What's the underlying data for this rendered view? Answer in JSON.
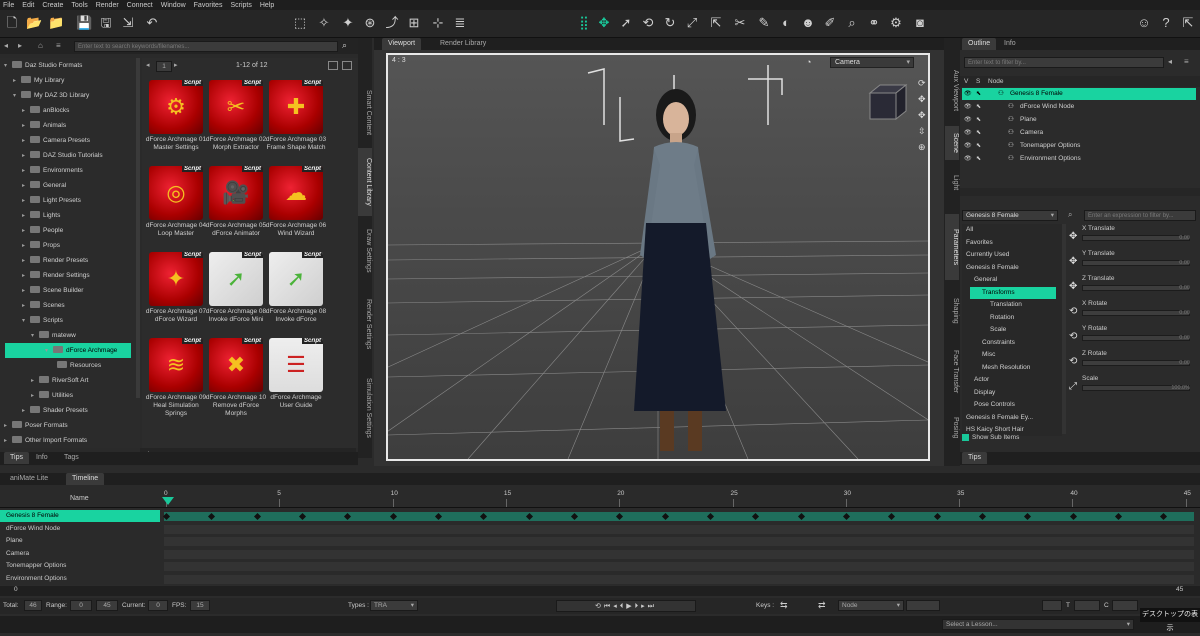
{
  "menu": [
    "File",
    "Edit",
    "Create",
    "Tools",
    "Render",
    "Connect",
    "Window",
    "Favorites",
    "Scripts",
    "Help"
  ],
  "left_panel": {
    "search_placeholder": "Enter text to search keywords/filenames...",
    "tree": [
      {
        "label": "Daz Studio Formats",
        "depth": 0,
        "arrow": "▾"
      },
      {
        "label": "My Library",
        "depth": 1,
        "arrow": "▸"
      },
      {
        "label": "My DAZ 3D Library",
        "depth": 1,
        "arrow": "▾"
      },
      {
        "label": "anBlocks",
        "depth": 2,
        "arrow": "▸"
      },
      {
        "label": "Animals",
        "depth": 2,
        "arrow": "▸"
      },
      {
        "label": "Camera Presets",
        "depth": 2,
        "arrow": "▸"
      },
      {
        "label": "DAZ Studio Tutorials",
        "depth": 2,
        "arrow": "▸"
      },
      {
        "label": "Environments",
        "depth": 2,
        "arrow": "▸"
      },
      {
        "label": "General",
        "depth": 2,
        "arrow": "▸"
      },
      {
        "label": "Light Presets",
        "depth": 2,
        "arrow": "▸"
      },
      {
        "label": "Lights",
        "depth": 2,
        "arrow": "▸"
      },
      {
        "label": "People",
        "depth": 2,
        "arrow": "▸"
      },
      {
        "label": "Props",
        "depth": 2,
        "arrow": "▸"
      },
      {
        "label": "Render Presets",
        "depth": 2,
        "arrow": "▸"
      },
      {
        "label": "Render Settings",
        "depth": 2,
        "arrow": "▸"
      },
      {
        "label": "Scene Builder",
        "depth": 2,
        "arrow": "▸"
      },
      {
        "label": "Scenes",
        "depth": 2,
        "arrow": "▸"
      },
      {
        "label": "Scripts",
        "depth": 2,
        "arrow": "▾"
      },
      {
        "label": "mateww",
        "depth": 3,
        "arrow": "▾"
      },
      {
        "label": "dForce Archmage",
        "depth": 4,
        "arrow": "▾",
        "selected": true
      },
      {
        "label": "Resources",
        "depth": 5,
        "arrow": ""
      },
      {
        "label": "RiverSoft Art",
        "depth": 3,
        "arrow": "▸"
      },
      {
        "label": "Utilities",
        "depth": 3,
        "arrow": "▸"
      },
      {
        "label": "Shader Presets",
        "depth": 2,
        "arrow": "▸"
      },
      {
        "label": "Poser Formats",
        "depth": 0,
        "arrow": "▸"
      },
      {
        "label": "Other Import Formats",
        "depth": 0,
        "arrow": "▸"
      }
    ],
    "page": "1",
    "count": "1-12 of 12",
    "badge": "Script",
    "thumbs": [
      {
        "caption": "dForce Archmage 01 Master Settings",
        "kind": "gear-icon"
      },
      {
        "caption": "dForce Archmage 02 Morph Extractor",
        "kind": "scissors-icon"
      },
      {
        "caption": "dForce Archmage 03 Frame Shape Match",
        "kind": "puzzle-icon"
      },
      {
        "caption": "dForce Archmage 04 Loop Master",
        "kind": "loop-icon"
      },
      {
        "caption": "dForce Archmage 05 dForce Animator",
        "kind": "camera-icon"
      },
      {
        "caption": "dForce Archmage 06 Wind Wizard",
        "kind": "tornado-icon"
      },
      {
        "caption": "dForce Archmage 07 dForce Wizard",
        "kind": "wizard-icon"
      },
      {
        "caption": "dForce Archmage 08 Invoke dForce Mini",
        "kind": "arrow-icon"
      },
      {
        "caption": "dForce Archmage 08 Invoke dForce",
        "kind": "arrow-icon"
      },
      {
        "caption": "dForce Archmage 09 Heal Simulation Springs",
        "kind": "spring-icon"
      },
      {
        "caption": "dForce Archmage 10 Remove dForce Morphs",
        "kind": "remove-icon"
      },
      {
        "caption": "dForce Archmage User Guide",
        "kind": "guide-icon"
      }
    ],
    "bottom_tabs": [
      "Tips",
      "Info",
      "Tags"
    ]
  },
  "side_tabs_left": [
    "Smart Content",
    "Content Library",
    "Draw Settings",
    "Render Settings",
    "Simulation Settings"
  ],
  "viewport": {
    "tabs": [
      "Viewport",
      "Render Library"
    ],
    "aspect": "4 : 3",
    "camera": "Camera"
  },
  "side_tabs_right": [
    "Aux Viewport",
    "Scene",
    "Light",
    "Parameters",
    "Shaping",
    "Face Transfer",
    "Posing"
  ],
  "scene": {
    "tabs": [
      "Outline",
      "Info"
    ],
    "filter_placeholder": "Enter text to filter by...",
    "col_v": "V",
    "col_s": "S",
    "col_node": "Node",
    "nodes": [
      {
        "label": "Genesis 8 Female",
        "selected": true
      },
      {
        "label": "dForce Wind Node"
      },
      {
        "label": "Plane"
      },
      {
        "label": "Camera"
      },
      {
        "label": "Tonemapper Options"
      },
      {
        "label": "Environment Options"
      }
    ]
  },
  "params": {
    "figure": "Genesis 8 Female",
    "filter_placeholder": "Enter an expression to filter by...",
    "tree": [
      {
        "label": "All",
        "depth": 0
      },
      {
        "label": "Favorites",
        "depth": 0
      },
      {
        "label": "Currently Used",
        "depth": 0
      },
      {
        "label": "Genesis 8 Female",
        "depth": 0
      },
      {
        "label": "General",
        "depth": 1
      },
      {
        "label": "Transforms",
        "depth": 2,
        "selected": true
      },
      {
        "label": "Translation",
        "depth": 3
      },
      {
        "label": "Rotation",
        "depth": 3
      },
      {
        "label": "Scale",
        "depth": 3
      },
      {
        "label": "Constraints",
        "depth": 2
      },
      {
        "label": "Misc",
        "depth": 2
      },
      {
        "label": "Mesh Resolution",
        "depth": 2
      },
      {
        "label": "Actor",
        "depth": 1
      },
      {
        "label": "Display",
        "depth": 1
      },
      {
        "label": "Pose Controls",
        "depth": 1
      },
      {
        "label": "Genesis 8 Female Ey...",
        "depth": 0
      },
      {
        "label": "HS Kaicy Short Hair",
        "depth": 0
      }
    ],
    "show_sub_items": "Show Sub Items",
    "sliders": [
      {
        "label": "X Translate",
        "value": "0.00"
      },
      {
        "label": "Y Translate",
        "value": "0.00"
      },
      {
        "label": "Z Translate",
        "value": "0.00"
      },
      {
        "label": "X Rotate",
        "value": "0.00"
      },
      {
        "label": "Y Rotate",
        "value": "0.00"
      },
      {
        "label": "Z Rotate",
        "value": "0.00"
      },
      {
        "label": "Scale",
        "value": "100.0%"
      }
    ],
    "tips": "Tips"
  },
  "timeline": {
    "tabs": [
      "aniMate Lite",
      "Timeline"
    ],
    "name_header": "Name",
    "ticks": [
      "0",
      "5",
      "10",
      "15",
      "20",
      "25",
      "30",
      "35",
      "40",
      "45"
    ],
    "rows": [
      "Genesis 8 Female",
      "dForce Wind Node",
      "Plane",
      "Camera",
      "Tonemapper Options",
      "Environment Options"
    ],
    "scroll_start": "0",
    "scroll_end": "45",
    "total_label": "Total:",
    "total": "46",
    "range_label": "Range:",
    "range_start": "0",
    "range_end": "45",
    "current_label": "Current:",
    "current": "0",
    "fps_label": "FPS:",
    "fps": "15",
    "types_label": "Types :",
    "types": "TRA",
    "keys_label": "Keys :",
    "node": "Node",
    "t_label": "T",
    "c_label": "C"
  },
  "status": {
    "lesson_placeholder": "Select a Lesson...",
    "desktop": "デスクトップの表示"
  }
}
